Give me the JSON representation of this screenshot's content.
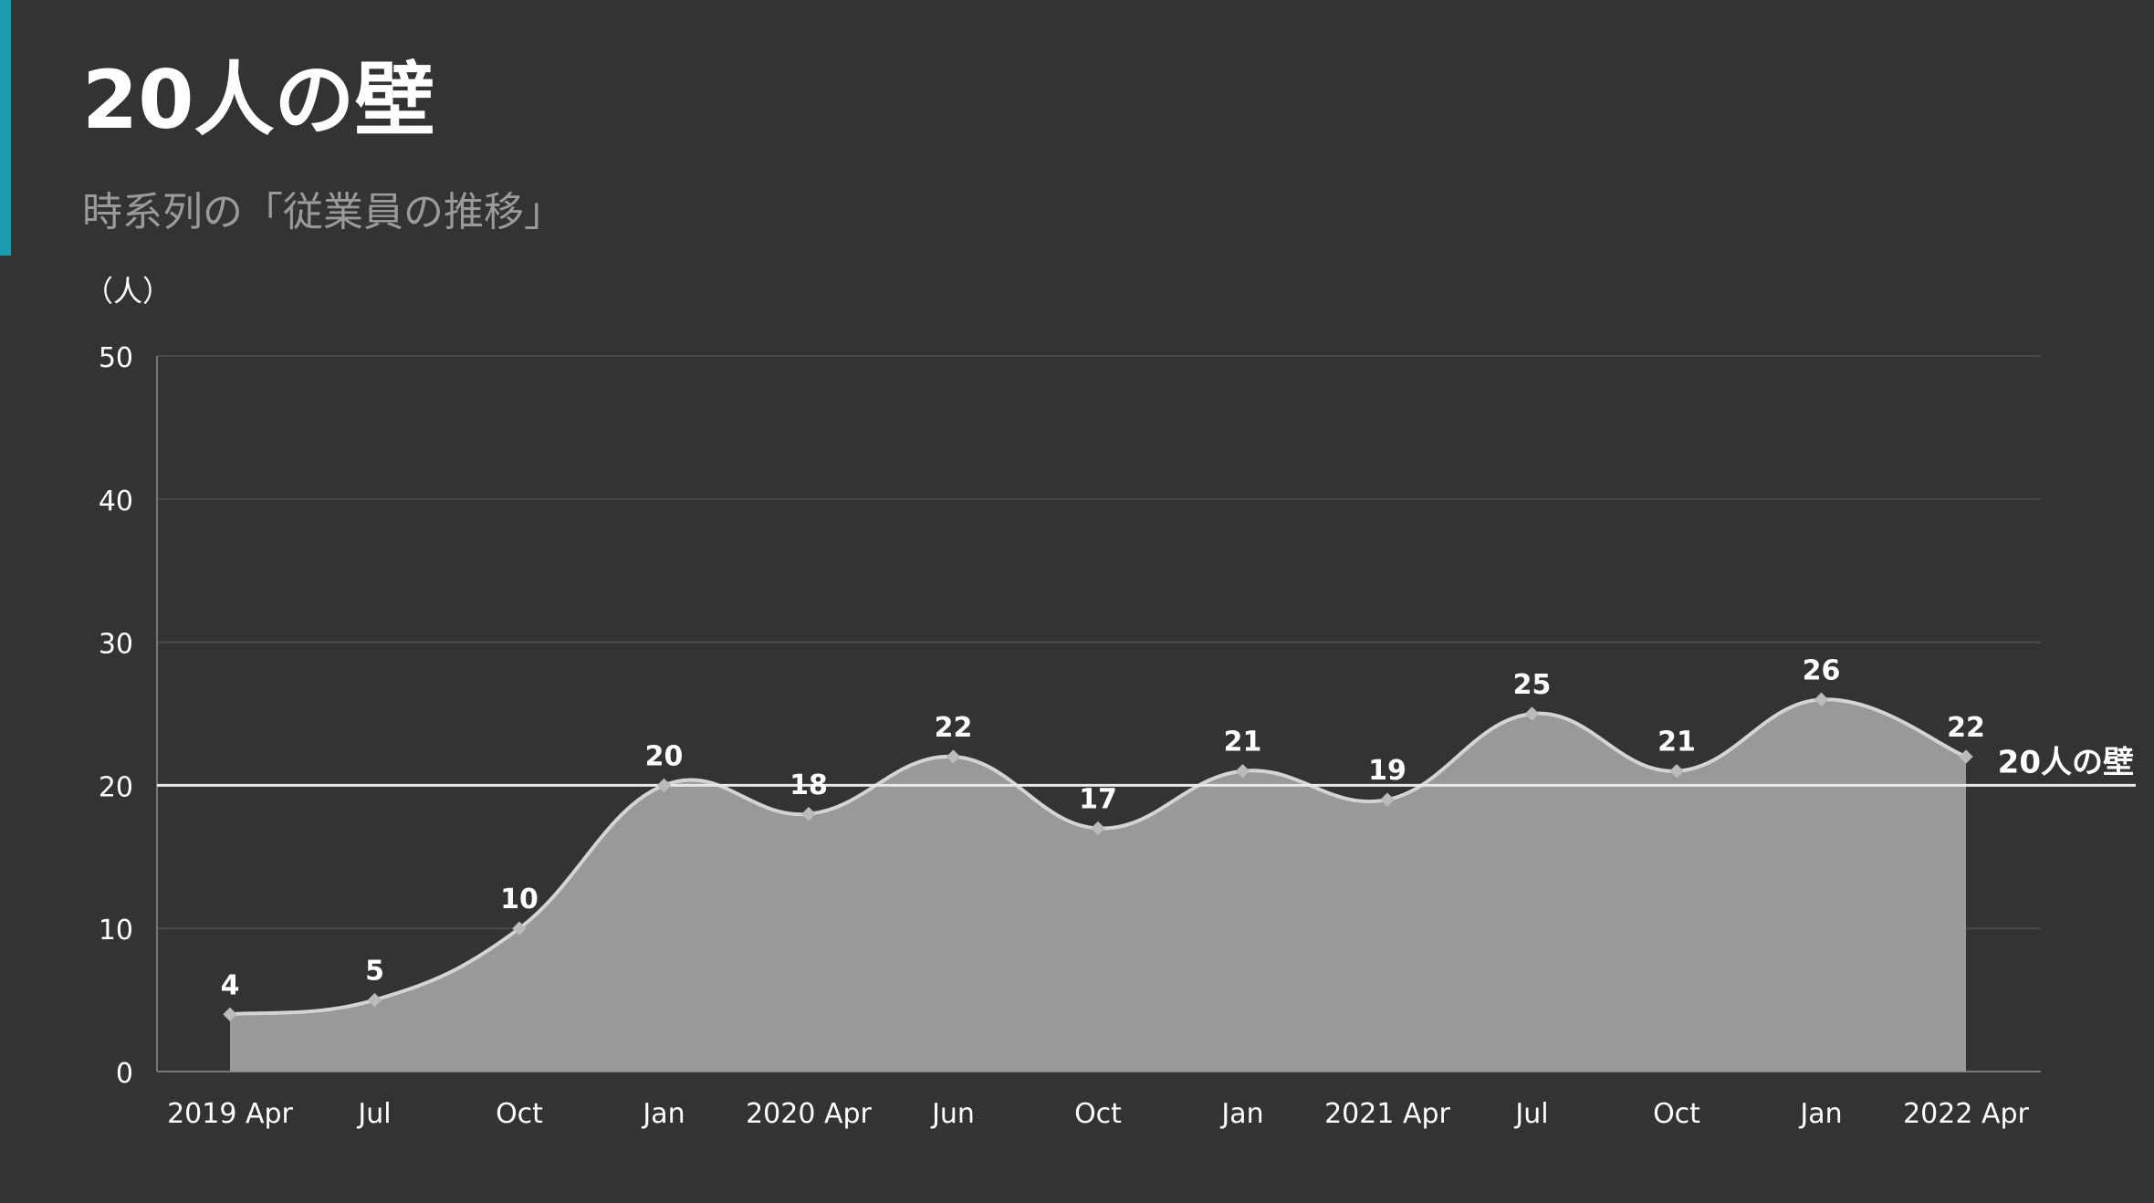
{
  "header": {
    "title": "20人の壁",
    "subtitle": "時系列の「従業員の推移」"
  },
  "colors": {
    "background": "#333333",
    "accent": "#1a9cb0",
    "area_fill": "#999999",
    "line": "#d4d4d4",
    "grid": "#4a4a4a",
    "axis_text": "#ffffff",
    "threshold": "#e8e8e8"
  },
  "chart_data": {
    "type": "area",
    "unit_label": "（人）",
    "categories": [
      "2019 Apr",
      "Jul",
      "Oct",
      "Jan",
      "2020 Apr",
      "Jun",
      "Oct",
      "Jan",
      "2021 Apr",
      "Jul",
      "Oct",
      "Jan",
      "2022 Apr"
    ],
    "values": [
      4,
      5,
      10,
      20,
      18,
      22,
      17,
      21,
      19,
      25,
      21,
      26,
      22
    ],
    "ylim": [
      0,
      50
    ],
    "yticks": [
      0,
      10,
      20,
      30,
      40,
      50
    ],
    "grid": true,
    "smooth": true,
    "data_labels": true,
    "threshold": {
      "value": 20,
      "label": "20人の壁"
    }
  }
}
